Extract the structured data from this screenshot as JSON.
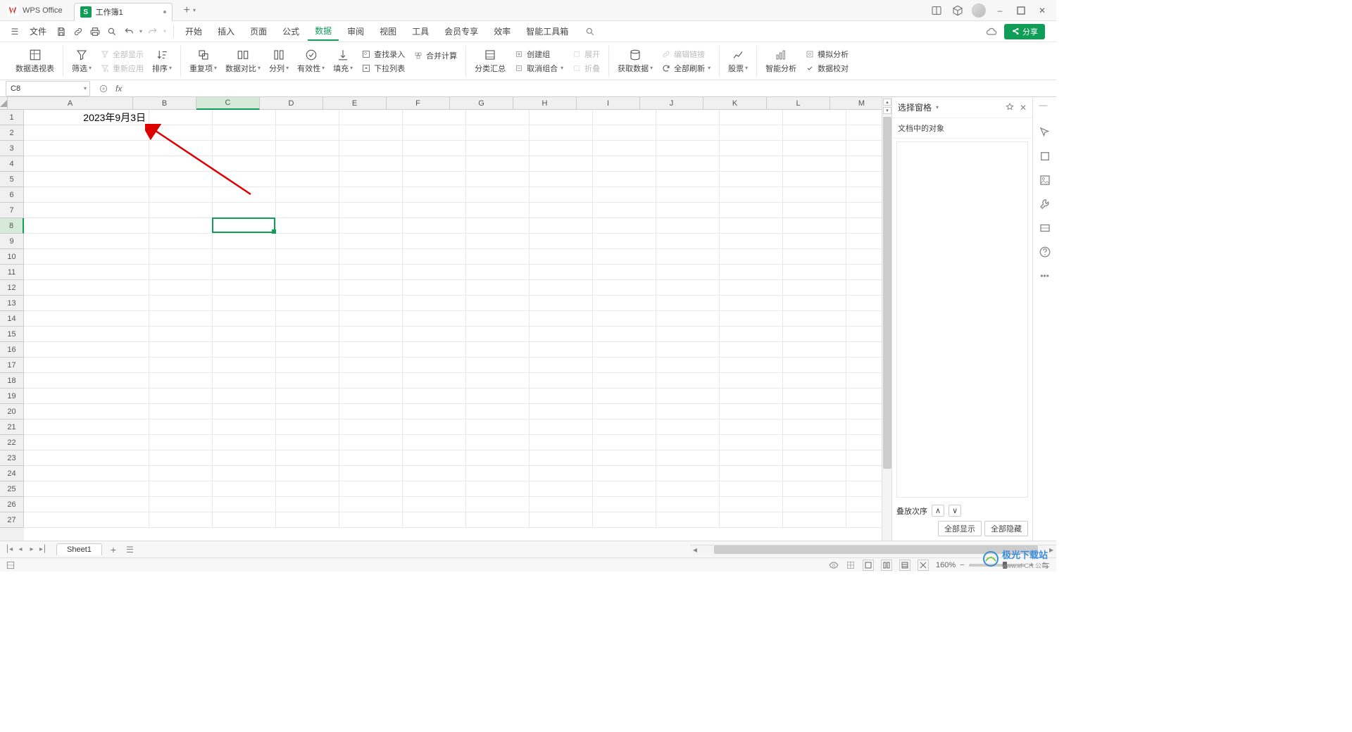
{
  "app": {
    "brand": "WPS Office"
  },
  "doc": {
    "icon_letter": "S",
    "name": "工作簿1"
  },
  "window_controls": {
    "minimize": "–",
    "maximize": "▢",
    "close": "✕"
  },
  "menubar": {
    "file": "文件",
    "items": [
      "开始",
      "插入",
      "页面",
      "公式",
      "数据",
      "审阅",
      "视图",
      "工具",
      "会员专享",
      "效率",
      "智能工具箱"
    ],
    "active_index": 4,
    "share": "分享"
  },
  "ribbon": {
    "pivot_table": "数据透视表",
    "filter": "筛选",
    "show_all": "全部显示",
    "reapply": "重新应用",
    "sort": "排序",
    "duplicates": "重复项",
    "data_compare": "数据对比",
    "split_col": "分列",
    "validity": "有效性",
    "fill": "填充",
    "lookup": "查找录入",
    "consolidate": "合并计算",
    "dropdown_list": "下拉列表",
    "subtotal": "分类汇总",
    "group_create": "创建组",
    "ungroup": "取消组合",
    "expand": "展开",
    "collapse": "折叠",
    "get_data": "获取数据",
    "edit_link": "编辑链接",
    "refresh_all": "全部刷新",
    "stocks": "股票",
    "smart_analysis": "智能分析",
    "simulation": "模拟分析",
    "data_validation": "数据校对"
  },
  "namebox": {
    "value": "C8"
  },
  "formula": {
    "value": ""
  },
  "columns": [
    "A",
    "B",
    "C",
    "D",
    "E",
    "F",
    "G",
    "H",
    "I",
    "J",
    "K",
    "L",
    "M"
  ],
  "rows": [
    1,
    2,
    3,
    4,
    5,
    6,
    7,
    8,
    9,
    10,
    11,
    12,
    13,
    14,
    15,
    16,
    17,
    18,
    19,
    20,
    21,
    22,
    23,
    24,
    25,
    26,
    27
  ],
  "cells": {
    "A1": "2023年9月3日"
  },
  "selection": {
    "col": "C",
    "row": 8
  },
  "right_panel": {
    "title": "选择窗格",
    "subtitle": "文档中的对象",
    "stacking": "叠放次序",
    "show_all": "全部显示",
    "hide_all": "全部隐藏"
  },
  "sheets": {
    "active": "Sheet1"
  },
  "statusbar": {
    "zoom": "160%"
  },
  "watermark": {
    "main": "极光下载站",
    "sub": "www.xf-CH.公司"
  }
}
